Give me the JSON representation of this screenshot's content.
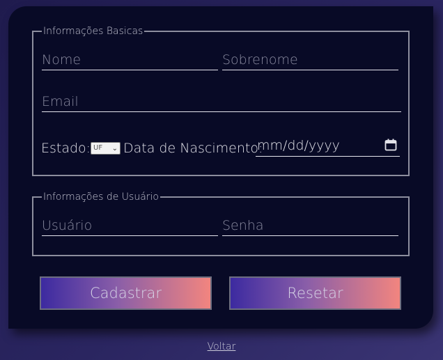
{
  "form": {
    "basic": {
      "legend": "Informações Basicas",
      "nome_placeholder": "Nome",
      "sobrenome_placeholder": "Sobrenome",
      "email_placeholder": "Email",
      "estado_label": "Estado:",
      "estado_selected": "UF",
      "nascimento_label": "Data de Nascimento:",
      "nascimento_placeholder": "mm/dd/yyyy"
    },
    "user": {
      "legend": "Informações de Usuário",
      "usuario_placeholder": "Usuário",
      "senha_placeholder": "Senha"
    },
    "buttons": {
      "cadastrar": "Cadastrar",
      "resetar": "Resetar"
    }
  },
  "footer": {
    "voltar": "Voltar"
  }
}
